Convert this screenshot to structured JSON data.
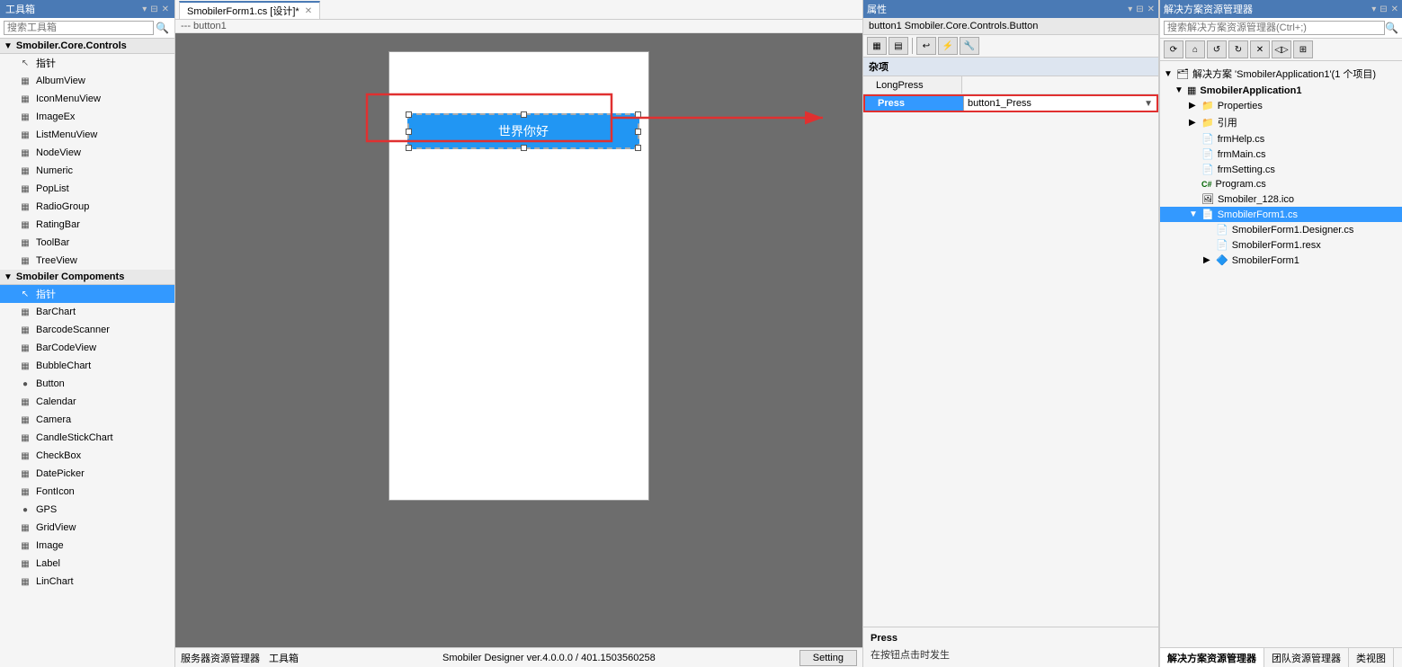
{
  "toolbox": {
    "title": "工具箱",
    "search_placeholder": "搜索工具箱",
    "group1": {
      "label": "Smobiler.Core.Controls",
      "items": [
        {
          "label": "指针",
          "icon": "↖"
        },
        {
          "label": "AlbumView",
          "icon": "▦"
        },
        {
          "label": "IconMenuView",
          "icon": "▦"
        },
        {
          "label": "ImageEx",
          "icon": "▦"
        },
        {
          "label": "ListMenuView",
          "icon": "▦"
        },
        {
          "label": "NodeView",
          "icon": "▦"
        },
        {
          "label": "Numeric",
          "icon": "▦"
        },
        {
          "label": "PopList",
          "icon": "▦"
        },
        {
          "label": "RadioGroup",
          "icon": "▦"
        },
        {
          "label": "RatingBar",
          "icon": "▦"
        },
        {
          "label": "ToolBar",
          "icon": "▦"
        },
        {
          "label": "TreeView",
          "icon": "▦"
        }
      ]
    },
    "group2": {
      "label": "Smobiler Compoments",
      "items": [
        {
          "label": "指针",
          "icon": "↖",
          "selected": true
        },
        {
          "label": "BarChart",
          "icon": "▦"
        },
        {
          "label": "BarcodeScanner",
          "icon": "▦"
        },
        {
          "label": "BarCodeView",
          "icon": "▦"
        },
        {
          "label": "BubbleChart",
          "icon": "▦"
        },
        {
          "label": "Button",
          "icon": "●"
        },
        {
          "label": "Calendar",
          "icon": "▦"
        },
        {
          "label": "Camera",
          "icon": "▦"
        },
        {
          "label": "CandleStickChart",
          "icon": "▦"
        },
        {
          "label": "CheckBox",
          "icon": "▦"
        },
        {
          "label": "DatePicker",
          "icon": "▦"
        },
        {
          "label": "FontIcon",
          "icon": "▦"
        },
        {
          "label": "GPS",
          "icon": "●"
        },
        {
          "label": "GridView",
          "icon": "▦"
        },
        {
          "label": "Image",
          "icon": "▦"
        },
        {
          "label": "Label",
          "icon": "▦"
        },
        {
          "label": "LinChart",
          "icon": "▦"
        }
      ]
    }
  },
  "tabs": [
    {
      "label": "SmobilerForm1.cs [设计]*",
      "active": true,
      "closeable": true
    }
  ],
  "designer": {
    "button_text": "世界你好",
    "breadcrumb": "--- button1"
  },
  "status_bar": {
    "left_text": "服务器资源管理器",
    "middle_text": "工具箱",
    "version": "Smobiler Designer ver.4.0.0.0 / 401.1503560258",
    "setting_btn": "Setting"
  },
  "properties": {
    "title": "属性",
    "object_label": "button1  Smobiler.Core.Controls.Button",
    "toolbar_btns": [
      "▦",
      "▦",
      "↩",
      "⚡",
      "🔧"
    ],
    "section_misc": "杂项",
    "rows": [
      {
        "name": "LongPress",
        "value": ""
      },
      {
        "name": "Press",
        "value": "button1_Press",
        "highlighted": true
      }
    ],
    "footer_title": "Press",
    "footer_desc": "在按钮点击时发生"
  },
  "solution": {
    "title": "解决方案资源管理器",
    "search_placeholder": "搜索解决方案资源管理器(Ctrl+;)",
    "toolbar_btns": [
      "⟳",
      "⌂",
      "↺",
      "↻",
      "✕",
      "☰",
      "◁▷",
      "⊞"
    ],
    "tree": [
      {
        "label": "解决方案 'SmobilerApplication1'(1 个项目)",
        "indent": 0,
        "expand": "▼",
        "icon": "🗂"
      },
      {
        "label": "SmobilerApplication1",
        "indent": 1,
        "expand": "▼",
        "icon": "▦",
        "bold": true
      },
      {
        "label": "Properties",
        "indent": 2,
        "expand": "▶",
        "icon": "📁"
      },
      {
        "label": "引用",
        "indent": 2,
        "expand": "▶",
        "icon": "📁"
      },
      {
        "label": "frmHelp.cs",
        "indent": 2,
        "expand": "",
        "icon": "📄"
      },
      {
        "label": "frmMain.cs",
        "indent": 2,
        "expand": "",
        "icon": "📄"
      },
      {
        "label": "frmSetting.cs",
        "indent": 2,
        "expand": "",
        "icon": "📄"
      },
      {
        "label": "Program.cs",
        "indent": 2,
        "expand": "",
        "icon": "C#"
      },
      {
        "label": "Smobiler_128.ico",
        "indent": 2,
        "expand": "",
        "icon": "🖼"
      },
      {
        "label": "SmobilerForm1.cs",
        "indent": 2,
        "expand": "▼",
        "icon": "📄",
        "selected": true
      },
      {
        "label": "SmobilerForm1.Designer.cs",
        "indent": 3,
        "expand": "",
        "icon": "📄"
      },
      {
        "label": "SmobilerForm1.resx",
        "indent": 3,
        "expand": "",
        "icon": "📄"
      },
      {
        "label": "SmobilerForm1",
        "indent": 3,
        "expand": "▶",
        "icon": "🔷"
      }
    ],
    "bottom_tabs": [
      {
        "label": "解决方案资源管理器",
        "active": true
      },
      {
        "label": "团队资源管理器"
      },
      {
        "label": "类视图"
      }
    ]
  },
  "colors": {
    "accent_blue": "#4a7ab5",
    "highlight_blue": "#3399ff",
    "button_blue": "#2196F3",
    "red": "#e03030"
  }
}
